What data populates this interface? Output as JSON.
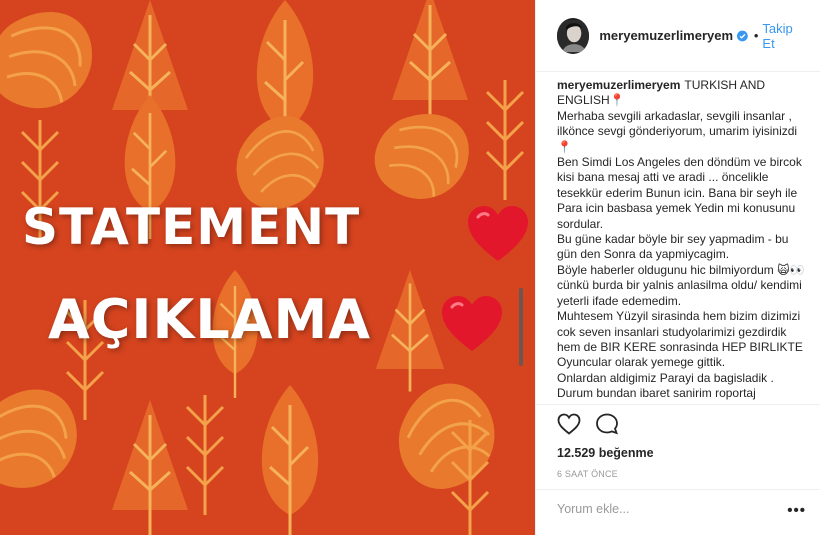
{
  "post": {
    "image": {
      "line1": "STATEMENT",
      "line2": "AÇIKLAMA",
      "background_color": "#d6441f",
      "heart_icon": "red-heart-emoji"
    },
    "header": {
      "username": "meryemuzerlimeryem",
      "verified_icon": "verified-badge-icon",
      "separator": "•",
      "follow_label": "Takip Et",
      "accent_color": "#3897f0"
    },
    "caption": {
      "username": "meryemuzerlimeryem",
      "lines": [
        "TURKISH AND ENGLISH📍",
        "Merhaba sevgili arkadaslar, sevgili insanlar , ilkönce sevgi gönderiyorum, umarim iyisinizdi📍",
        "Ben Simdi Los Angeles den döndüm ve bircok kisi bana mesaj atti ve aradi ... öncelikle tesekkür ederim Bunun icin. Bana bir seyh ile Para icin basbasa yemek Yedin mi konusunu sordular.",
        "Bu güne kadar böyle bir sey yapmadim - bu gün den Sonra da yapmiycagim.",
        "Böyle haberler oldugunu hic bilmiyordum 🙀👀 cünkü burda bir yalnis anlasilma oldu/ kendimi yeterli ifade edemedim.",
        "Muhtesem Yüzyil sirasinda hem bizim dizimizi cok seven insanlari studyolarimizi gezdirdik hem de BIR KERE sonrasinda HEP BIRLIKTE Oyuncular olarak yemege gittik.",
        "Onlardan aldigimiz Parayi da bagisladik .",
        "Durum bundan ibaret sanirim roportaj"
      ]
    },
    "actions": {
      "like_icon": "heart-outline-icon",
      "comment_icon": "comment-bubble-icon"
    },
    "likes_text": "12.529 beğenme",
    "time_text": "6 SAAT ÖNCE",
    "comment_input": {
      "placeholder": "Yorum ekle..."
    },
    "more_options_label": "•••"
  }
}
